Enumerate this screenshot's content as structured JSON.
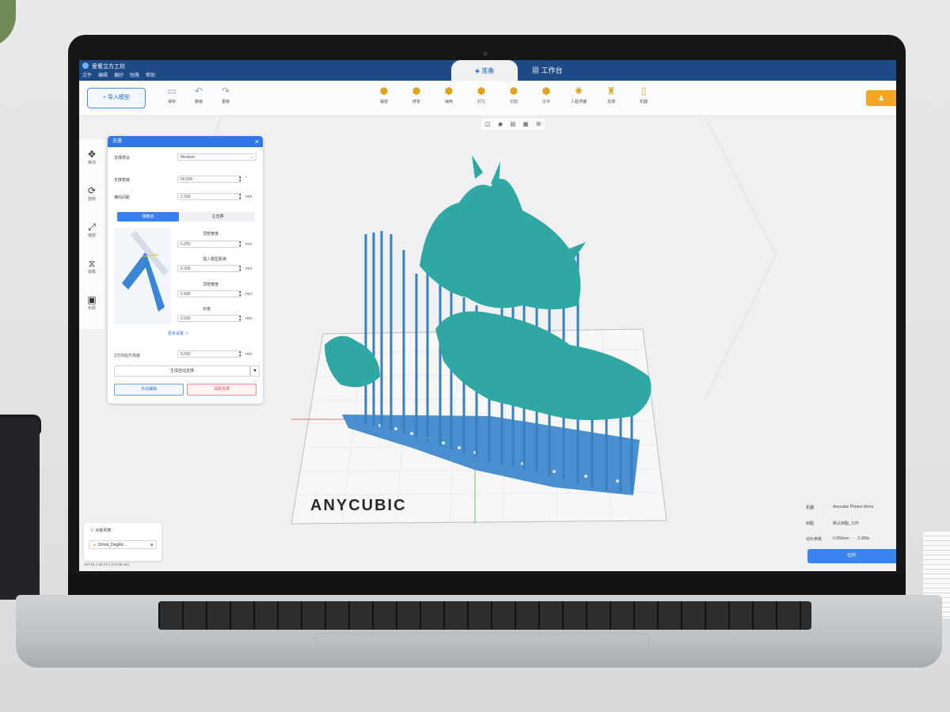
{
  "app": {
    "title": "爱看立方工坊",
    "menus": [
      "文件",
      "编辑",
      "偏好",
      "短路",
      "帮助"
    ],
    "tabs": {
      "prepare": "准备",
      "workbench": "工作台"
    }
  },
  "toolbar": {
    "import_label": "导入模型",
    "left_items": [
      {
        "label": "保存",
        "icon": "save-icon"
      },
      {
        "label": "撤销",
        "icon": "undo-icon"
      },
      {
        "label": "重做",
        "icon": "redo-icon"
      }
    ],
    "center_items": [
      {
        "label": "摆放",
        "icon": "layout-icon"
      },
      {
        "label": "修复",
        "icon": "repair-icon"
      },
      {
        "label": "抽壳",
        "icon": "hollow-icon"
      },
      {
        "label": "打孔",
        "icon": "punch-icon"
      },
      {
        "label": "切割",
        "icon": "cut-icon"
      },
      {
        "label": "文字",
        "icon": "text-icon"
      },
      {
        "label": "人脸浮雕",
        "icon": "relief-icon"
      },
      {
        "label": "支撑",
        "icon": "support-icon"
      },
      {
        "label": "机器",
        "icon": "machine-icon"
      }
    ]
  },
  "left_tools": [
    {
      "label": "移动",
      "icon": "move-icon"
    },
    {
      "label": "旋转",
      "icon": "rotate-icon"
    },
    {
      "label": "缩放",
      "icon": "scale-icon"
    },
    {
      "label": "镜像",
      "icon": "mirror-icon"
    },
    {
      "label": "布局",
      "icon": "layout-tool-icon"
    }
  ],
  "support_panel": {
    "title": "支撑",
    "preset_label": "支撑预设",
    "preset_value": "Medium",
    "angle_label": "支撑角度",
    "angle_value": "50.000",
    "angle_unit": "°",
    "density_label": "横向间距",
    "density_value": "2.300",
    "density_unit": "mm",
    "tab_contact": "接触点",
    "tab_main": "主支撑",
    "fields": [
      {
        "label": "顶部宽度",
        "value": "0.250",
        "unit": "mm"
      },
      {
        "label": "插入模型距离",
        "value": "0.300",
        "unit": "mm"
      },
      {
        "label": "顶部宽度",
        "value": "0.400",
        "unit": "mm"
      },
      {
        "label": "长度",
        "value": "2.000",
        "unit": "mm"
      }
    ],
    "more_label": "更多设置 ∨",
    "lift_label": "Z方向抬升高度",
    "lift_value": "5.000",
    "lift_unit": "mm",
    "auto_label": "生成自动支撑",
    "manual_label": "手动编辑",
    "clear_label": "清除支撑"
  },
  "viewport": {
    "brand": "ANYCUBIC",
    "view_icons": [
      "cube-icon",
      "eye-icon",
      "layers-icon",
      "grid-icon",
      "gear-icon"
    ]
  },
  "object_list": {
    "title": "对象列表",
    "item": "32mm_DogRd...",
    "size": "167.51 x 93.72 x 174.38 mm"
  },
  "machine_info": {
    "machine_label": "机器",
    "machine_value": "Anycubic Photon Mono",
    "material_label": "树脂",
    "material_value": "默认树脂_工作",
    "layer_label": "切片参数",
    "layer_value": "0.050mm · · · 2.000s",
    "slice_label": "切片"
  },
  "colors": {
    "title_bar": "#1e4a86",
    "accent": "#3176e8",
    "model": "#2fa8a4",
    "support": "#3e86c7",
    "highlight": "#f5a623"
  }
}
